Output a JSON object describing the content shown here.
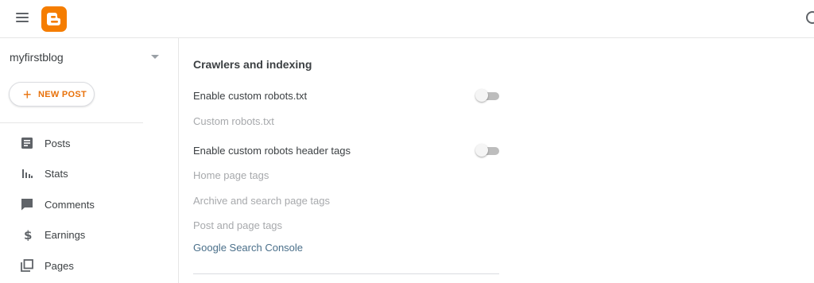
{
  "header": {
    "menu_icon": "hamburger-menu-icon",
    "logo_icon": "blogger-logo",
    "search_icon": "search-icon",
    "brand_color": "#f57d00"
  },
  "sidebar": {
    "blog_name": "myfirstblog",
    "new_post_label": "NEW POST",
    "accent_color": "#e8710a",
    "items": [
      {
        "label": "Posts",
        "icon": "posts-icon"
      },
      {
        "label": "Stats",
        "icon": "stats-icon"
      },
      {
        "label": "Comments",
        "icon": "comments-icon"
      },
      {
        "label": "Earnings",
        "icon": "dollar-icon"
      },
      {
        "label": "Pages",
        "icon": "pages-icon"
      }
    ]
  },
  "main": {
    "section_title": "Crawlers and indexing",
    "settings": [
      {
        "label": "Enable custom robots.txt",
        "type": "toggle",
        "enabled": false
      },
      {
        "label": "Custom robots.txt",
        "type": "disabled-text"
      },
      {
        "label": "Enable custom robots header tags",
        "type": "toggle",
        "enabled": false
      },
      {
        "label": "Home page tags",
        "type": "disabled-text"
      },
      {
        "label": "Archive and search page tags",
        "type": "disabled-text"
      },
      {
        "label": "Post and page tags",
        "type": "disabled-text"
      },
      {
        "label": "Google Search Console",
        "type": "link"
      }
    ]
  }
}
